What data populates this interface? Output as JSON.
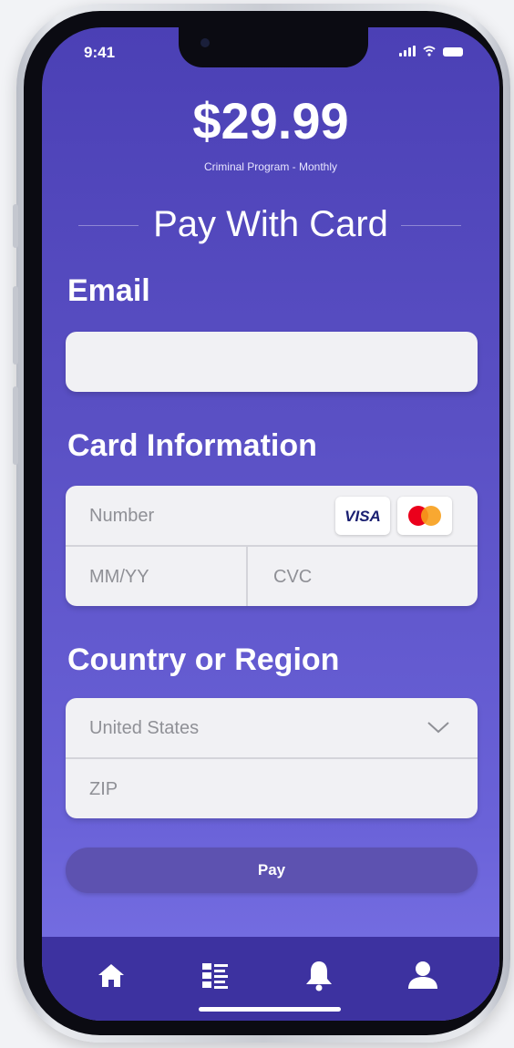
{
  "status_bar": {
    "time": "9:41"
  },
  "header": {
    "price": "$29.99",
    "plan": "Criminal Program - Monthly",
    "title": "Pay With Card"
  },
  "email": {
    "label": "Email",
    "value": "",
    "placeholder": ""
  },
  "card": {
    "label": "Card Information",
    "number_placeholder": "Number",
    "expiry_placeholder": "MM/YY",
    "cvc_placeholder": "CVC",
    "brand_visa": "VISA",
    "brand_mastercard_icon": "mastercard-icon"
  },
  "region": {
    "label": "Country or Region",
    "country_value": "United States",
    "zip_placeholder": "ZIP"
  },
  "pay_button": {
    "label": "Pay"
  },
  "tabbar": {
    "items": [
      {
        "icon": "home-icon"
      },
      {
        "icon": "list-icon"
      },
      {
        "icon": "bell-icon"
      },
      {
        "icon": "user-icon"
      }
    ]
  },
  "colors": {
    "accent": "#4b40b5",
    "tabbar": "#3d32a0",
    "button": "#5d52b0"
  }
}
